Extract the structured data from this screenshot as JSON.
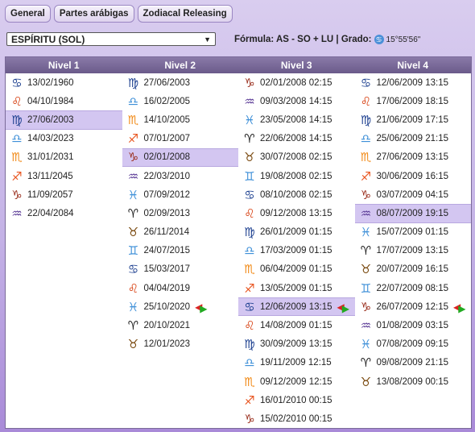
{
  "tabs": [
    "General",
    "Partes arábigas",
    "Zodiacal Releasing"
  ],
  "select": {
    "value": "ESPÍRITU (SOL)"
  },
  "formula": {
    "label": "Fórmula: AS - SO + LU | Grado:",
    "degree": "15°55'56\""
  },
  "headers": [
    "Nivel 1",
    "Nivel 2",
    "Nivel 3",
    "Nivel 4"
  ],
  "colors": {
    "cancer": "#1c3f8f",
    "leo": "#d63a0a",
    "virgo": "#1c3f8f",
    "libra": "#3d8fd8",
    "scorpio": "#f18a17",
    "sagittarius": "#e85520",
    "capricorn": "#9a2f1e",
    "aquarius": "#5a3a96",
    "pisces": "#3d8fd8",
    "aries": "#1a1a1a",
    "taurus": "#7a4a10",
    "gemini": "#3d8fd8"
  },
  "columns": [
    {
      "rows": [
        {
          "sign": "cancer",
          "glyph": "♋",
          "date": "13/02/1960"
        },
        {
          "sign": "leo",
          "glyph": "♌",
          "date": "04/10/1984"
        },
        {
          "sign": "virgo",
          "glyph": "♍",
          "date": "27/06/2003",
          "selected": true
        },
        {
          "sign": "libra",
          "glyph": "♎",
          "date": "14/03/2023"
        },
        {
          "sign": "scorpio",
          "glyph": "♏",
          "date": "31/01/2031"
        },
        {
          "sign": "sagittarius",
          "glyph": "♐",
          "date": "13/11/2045"
        },
        {
          "sign": "capricorn",
          "glyph": "♑",
          "date": "11/09/2057"
        },
        {
          "sign": "aquarius",
          "glyph": "♒",
          "date": "22/04/2084"
        }
      ]
    },
    {
      "rows": [
        {
          "sign": "virgo",
          "glyph": "♍",
          "date": "27/06/2003"
        },
        {
          "sign": "libra",
          "glyph": "♎",
          "date": "16/02/2005"
        },
        {
          "sign": "scorpio",
          "glyph": "♏",
          "date": "14/10/2005"
        },
        {
          "sign": "sagittarius",
          "glyph": "♐",
          "date": "07/01/2007"
        },
        {
          "sign": "capricorn",
          "glyph": "♑",
          "date": "02/01/2008",
          "selected": true
        },
        {
          "sign": "aquarius",
          "glyph": "♒",
          "date": "22/03/2010"
        },
        {
          "sign": "pisces",
          "glyph": "♓",
          "date": "07/09/2012"
        },
        {
          "sign": "aries",
          "glyph": "♈",
          "date": "02/09/2013"
        },
        {
          "sign": "taurus",
          "glyph": "♉",
          "date": "26/11/2014"
        },
        {
          "sign": "gemini",
          "glyph": "♊",
          "date": "24/07/2015"
        },
        {
          "sign": "cancer",
          "glyph": "♋",
          "date": "15/03/2017"
        },
        {
          "sign": "leo",
          "glyph": "♌",
          "date": "04/04/2019"
        },
        {
          "sign": "pisces",
          "glyph": "♓",
          "date": "25/10/2020",
          "arrows": true
        },
        {
          "sign": "aries",
          "glyph": "♈",
          "date": "20/10/2021"
        },
        {
          "sign": "taurus",
          "glyph": "♉",
          "date": "12/01/2023"
        }
      ]
    },
    {
      "rows": [
        {
          "sign": "capricorn",
          "glyph": "♑",
          "date": "02/01/2008 02:15"
        },
        {
          "sign": "aquarius",
          "glyph": "♒",
          "date": "09/03/2008 14:15"
        },
        {
          "sign": "pisces",
          "glyph": "♓",
          "date": "23/05/2008 14:15"
        },
        {
          "sign": "aries",
          "glyph": "♈",
          "date": "22/06/2008 14:15"
        },
        {
          "sign": "taurus",
          "glyph": "♉",
          "date": "30/07/2008 02:15"
        },
        {
          "sign": "gemini",
          "glyph": "♊",
          "date": "19/08/2008 02:15"
        },
        {
          "sign": "cancer",
          "glyph": "♋",
          "date": "08/10/2008 02:15"
        },
        {
          "sign": "leo",
          "glyph": "♌",
          "date": "09/12/2008 13:15"
        },
        {
          "sign": "virgo",
          "glyph": "♍",
          "date": "26/01/2009 01:15"
        },
        {
          "sign": "libra",
          "glyph": "♎",
          "date": "17/03/2009 01:15"
        },
        {
          "sign": "scorpio",
          "glyph": "♏",
          "date": "06/04/2009 01:15"
        },
        {
          "sign": "sagittarius",
          "glyph": "♐",
          "date": "13/05/2009 01:15"
        },
        {
          "sign": "cancer",
          "glyph": "♋",
          "date": "12/06/2009 13:15",
          "selected": true,
          "arrows": true
        },
        {
          "sign": "leo",
          "glyph": "♌",
          "date": "14/08/2009 01:15"
        },
        {
          "sign": "virgo",
          "glyph": "♍",
          "date": "30/09/2009 13:15"
        },
        {
          "sign": "libra",
          "glyph": "♎",
          "date": "19/11/2009 12:15"
        },
        {
          "sign": "scorpio",
          "glyph": "♏",
          "date": "09/12/2009 12:15"
        },
        {
          "sign": "sagittarius",
          "glyph": "♐",
          "date": "16/01/2010 00:15"
        },
        {
          "sign": "capricorn",
          "glyph": "♑",
          "date": "15/02/2010 00:15"
        }
      ]
    },
    {
      "rows": [
        {
          "sign": "cancer",
          "glyph": "♋",
          "date": "12/06/2009 13:15"
        },
        {
          "sign": "leo",
          "glyph": "♌",
          "date": "17/06/2009 18:15"
        },
        {
          "sign": "virgo",
          "glyph": "♍",
          "date": "21/06/2009 17:15"
        },
        {
          "sign": "libra",
          "glyph": "♎",
          "date": "25/06/2009 21:15"
        },
        {
          "sign": "scorpio",
          "glyph": "♏",
          "date": "27/06/2009 13:15"
        },
        {
          "sign": "sagittarius",
          "glyph": "♐",
          "date": "30/06/2009 16:15"
        },
        {
          "sign": "capricorn",
          "glyph": "♑",
          "date": "03/07/2009 04:15"
        },
        {
          "sign": "aquarius",
          "glyph": "♒",
          "date": "08/07/2009 19:15",
          "selected": true
        },
        {
          "sign": "pisces",
          "glyph": "♓",
          "date": "15/07/2009 01:15"
        },
        {
          "sign": "aries",
          "glyph": "♈",
          "date": "17/07/2009 13:15"
        },
        {
          "sign": "taurus",
          "glyph": "♉",
          "date": "20/07/2009 16:15"
        },
        {
          "sign": "gemini",
          "glyph": "♊",
          "date": "22/07/2009 08:15"
        },
        {
          "sign": "capricorn",
          "glyph": "♑",
          "date": "26/07/2009 12:15",
          "arrows": true
        },
        {
          "sign": "aquarius",
          "glyph": "♒",
          "date": "01/08/2009 03:15"
        },
        {
          "sign": "pisces",
          "glyph": "♓",
          "date": "07/08/2009 09:15"
        },
        {
          "sign": "aries",
          "glyph": "♈",
          "date": "09/08/2009 21:15"
        },
        {
          "sign": "taurus",
          "glyph": "♉",
          "date": "13/08/2009 00:15"
        }
      ]
    }
  ]
}
